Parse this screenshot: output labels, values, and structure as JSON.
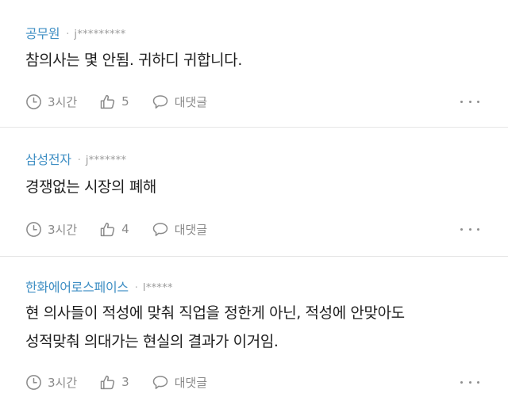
{
  "colors": {
    "author_accent": "#3f8fc4",
    "meta_gray": "#8a8a8a",
    "divider": "#e6e6e6"
  },
  "comments": [
    {
      "author": "공무원",
      "separator": "·",
      "user_id": "j*********",
      "text_lines": [
        "참의사는 몇 안됨. 귀하디 귀합니다."
      ],
      "time": "3시간",
      "likes": "5",
      "reply_label": "대댓글"
    },
    {
      "author": "삼성전자",
      "separator": "·",
      "user_id": "j*******",
      "text_lines": [
        "경쟁없는 시장의 폐해"
      ],
      "time": "3시간",
      "likes": "4",
      "reply_label": "대댓글"
    },
    {
      "author": "한화에어로스페이스",
      "separator": "·",
      "user_id": "l*****",
      "text_lines": [
        "현 의사들이 적성에 맞춰 직업을 정한게 아닌, 적성에 안맞아도",
        "성적맞춰 의대가는 현실의 결과가 이거임."
      ],
      "time": "3시간",
      "likes": "3",
      "reply_label": "대댓글"
    }
  ],
  "icons": {
    "time": "clock-icon",
    "like": "thumbs-up-icon",
    "reply": "speech-bubble-icon",
    "more": "more-horizontal-icon"
  }
}
